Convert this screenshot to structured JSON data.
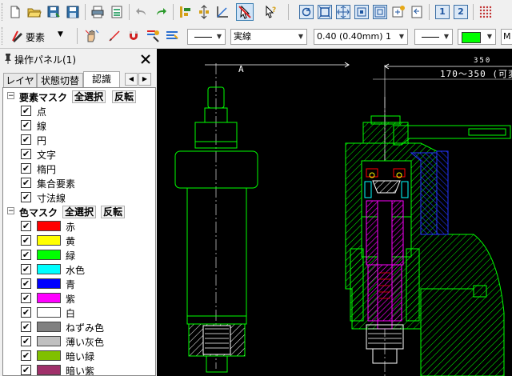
{
  "toolbar_top": {
    "icons": [
      "new-file-icon",
      "open-folder-icon",
      "save-as-icon",
      "save-icon",
      "print-icon",
      "print-preview-icon",
      "undo-icon",
      "redo-icon",
      "align-tool-icon",
      "distribute-icon",
      "angle-icon",
      "select-arrow-icon",
      "query-icon",
      "refresh-view-icon",
      "zoom-fit-icon",
      "zoom-window-icon",
      "zoom-in-icon",
      "zoom-out-icon",
      "pan-icon",
      "previous-view-icon",
      "viewport-1-icon",
      "viewport-2-icon",
      "grid-dots-icon"
    ]
  },
  "toolbar_props": {
    "element_button_label": "要素",
    "line_style_value": "実線",
    "line_width_value": "0.40 (0.40mm) 1",
    "color_value": "#00ff00",
    "truncated_label": "M"
  },
  "panel": {
    "title": "操作パネル(1)",
    "tabs": [
      {
        "label": "レイヤ",
        "active": false
      },
      {
        "label": "状態切替",
        "active": false
      },
      {
        "label": "認識",
        "active": true
      }
    ],
    "element_mask": {
      "title": "要素マスク",
      "select_all": "全選択",
      "invert": "反転",
      "items": [
        {
          "label": "点",
          "checked": true
        },
        {
          "label": "線",
          "checked": true
        },
        {
          "label": "円",
          "checked": true
        },
        {
          "label": "文字",
          "checked": true
        },
        {
          "label": "楕円",
          "checked": true
        },
        {
          "label": "集合要素",
          "checked": true
        },
        {
          "label": "寸法線",
          "checked": true
        }
      ]
    },
    "color_mask": {
      "title": "色マスク",
      "select_all": "全選択",
      "invert": "反転",
      "items": [
        {
          "label": "赤",
          "color": "#ff0000",
          "checked": true
        },
        {
          "label": "黄",
          "color": "#ffff00",
          "checked": true
        },
        {
          "label": "緑",
          "color": "#00ff00",
          "checked": true
        },
        {
          "label": "水色",
          "color": "#00ffff",
          "checked": true
        },
        {
          "label": "青",
          "color": "#0000ff",
          "checked": true
        },
        {
          "label": "紫",
          "color": "#ff00ff",
          "checked": true
        },
        {
          "label": "白",
          "color": "#ffffff",
          "checked": true
        },
        {
          "label": "ねずみ色",
          "color": "#808080",
          "checked": true
        },
        {
          "label": "薄い灰色",
          "color": "#c0c0c0",
          "checked": true
        },
        {
          "label": "暗い緑",
          "color": "#80c000",
          "checked": true
        },
        {
          "label": "暗い紫",
          "color": "#a0306a",
          "checked": true
        }
      ]
    }
  },
  "drawing": {
    "label_a": "A",
    "dim_value": "350",
    "dim_range_text": "170～350 (可変",
    "colors": {
      "outline": "#00ff00",
      "white": "#ffffff",
      "red": "#ff0000",
      "yellow": "#ffff00",
      "blue": "#0000ff",
      "magenta": "#ff00ff",
      "cyan": "#00ffff"
    }
  }
}
